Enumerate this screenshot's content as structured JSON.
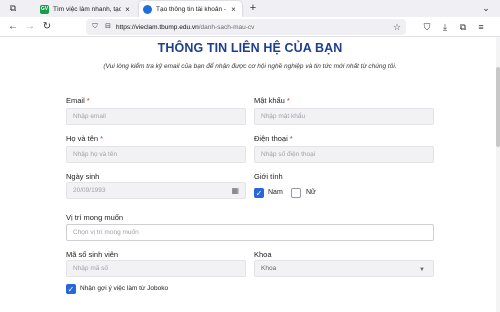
{
  "browser": {
    "tabs": [
      {
        "title": "Tìm việc làm nhanh, tạo cv xin",
        "favicon": "GV",
        "active": false
      },
      {
        "title": "Tạo thông tin tài khoản - tbum",
        "favicon": "",
        "active": true
      }
    ],
    "new_tab_label": "+",
    "url_host": "https://vieclam.tbump.edu.vn",
    "url_path": "/danh-sach-mau-cv"
  },
  "form": {
    "title": "THÔNG TIN LIÊN HỆ CỦA BẠN",
    "note": "(Vui lòng kiểm tra kỹ email của bạn để nhận được cơ hội nghề nghiệp và tin tức mới nhất từ chúng tôi.",
    "email": {
      "label": "Email",
      "required": "*",
      "placeholder": "Nhập email"
    },
    "password": {
      "label": "Mật khẩu",
      "required": "*",
      "placeholder": "Nhập mật khẩu"
    },
    "fullname": {
      "label": "Họ và tên",
      "required": "*",
      "placeholder": "Nhập họ và tên"
    },
    "phone": {
      "label": "Điện thoại",
      "required": "*",
      "placeholder": "Nhập số điện thoại"
    },
    "dob": {
      "label": "Ngày sinh",
      "placeholder": "20/09/1993"
    },
    "gender": {
      "label": "Giới tính",
      "options": [
        "Nam",
        "Nữ"
      ],
      "selected": "Nam"
    },
    "position": {
      "label": "Vị trí mong muốn",
      "placeholder": "Chọn vị trí mong muốn"
    },
    "student_id": {
      "label": "Mã số sinh viên",
      "placeholder": "Nhập mã số"
    },
    "faculty": {
      "label": "Khoa",
      "value": "Khoa"
    },
    "suggest": {
      "label": "Nhận gợi ý việc làm từ Joboko",
      "checked": true
    }
  },
  "colors": {
    "title": "#1d3f8f",
    "required": "#e02424",
    "checkbox": "#2a66d8"
  }
}
